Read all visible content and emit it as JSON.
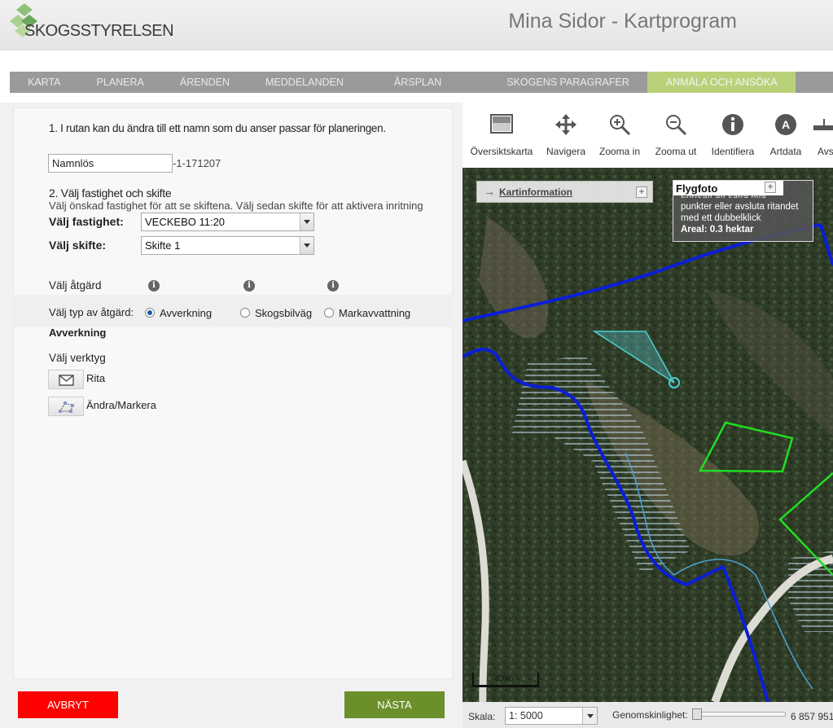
{
  "header": {
    "logo_text": "SKOGSSTYRELSEN",
    "app_title": "Mina Sidor - Kartprogram"
  },
  "nav": {
    "items": [
      {
        "label": "KARTA"
      },
      {
        "label": "PLANERA"
      },
      {
        "label": "ÄRENDEN"
      },
      {
        "label": "MEDDELANDEN"
      },
      {
        "label": "ÅRSPLAN"
      },
      {
        "label": "SKOGENS PARAGRAFER"
      },
      {
        "label": "ANMÄLA OCH ANSÖKA"
      }
    ],
    "active_color": "#b9d27a"
  },
  "form": {
    "step1_heading": "1. I rutan kan du ändra till ett namn som du anser passar för planeringen.",
    "name_value": "Namnlös",
    "name_suffix": "-1-171207",
    "step2_heading": "2. Välj fastighet och skifte",
    "step2_help": "Välj önskad fastighet för att se skiftena. Välj sedan skifte för att aktivera inritning",
    "fastighet_label": "Välj fastighet:",
    "fastighet_value": "VECKEBO 11:20",
    "skifte_label": "Välj skifte:",
    "skifte_value": "Skifte 1",
    "atgard_label": "Välj åtgärd",
    "typ_label": "Välj typ av åtgärd:",
    "options": [
      {
        "label": "Avverkning",
        "checked": true
      },
      {
        "label": "Skogsbilväg",
        "checked": false
      },
      {
        "label": "Markavvattning",
        "checked": false
      }
    ],
    "selected_action": "Avverkning",
    "verktyg_label": "Välj verktyg",
    "tools": [
      {
        "label": "Rita",
        "icon": "draw-polygon-icon"
      },
      {
        "label": "Ändra/Markera",
        "icon": "edit-vertices-icon"
      }
    ]
  },
  "buttons": {
    "cancel": "AVBRYT",
    "next": "NÄSTA",
    "cancel_color": "#ff0000",
    "next_color": "#6a8f2b"
  },
  "map_toolbar": {
    "tools": [
      {
        "label": "Översiktskarta",
        "icon": "overview-map-icon"
      },
      {
        "label": "Navigera",
        "icon": "pan-arrows-icon"
      },
      {
        "label": "Zooma in",
        "icon": "zoom-in-icon"
      },
      {
        "label": "Zooma ut",
        "icon": "zoom-out-icon"
      },
      {
        "label": "Identifiera",
        "icon": "info-icon"
      },
      {
        "label": "Artdata",
        "icon": "artdata-icon"
      },
      {
        "label": "Avst",
        "icon": "measure-icon"
      }
    ]
  },
  "map": {
    "kartinfo_label": "Kartinformation",
    "flygfoto_title": "Flygfoto",
    "flygfoto_line0": "Fortsätt att sätta nya",
    "flygfoto_line1": "punkter eller avsluta ritandet",
    "flygfoto_line2": "med ett dubbelklick",
    "flygfoto_area": "Areal: 0.3 hektar",
    "scalebar_label": "100m"
  },
  "statusbar": {
    "scale_label": "Skala:",
    "scale_value": "1: 5000",
    "transparency_label": "Genomskinlighet:",
    "coordinate": "6 857 951"
  }
}
